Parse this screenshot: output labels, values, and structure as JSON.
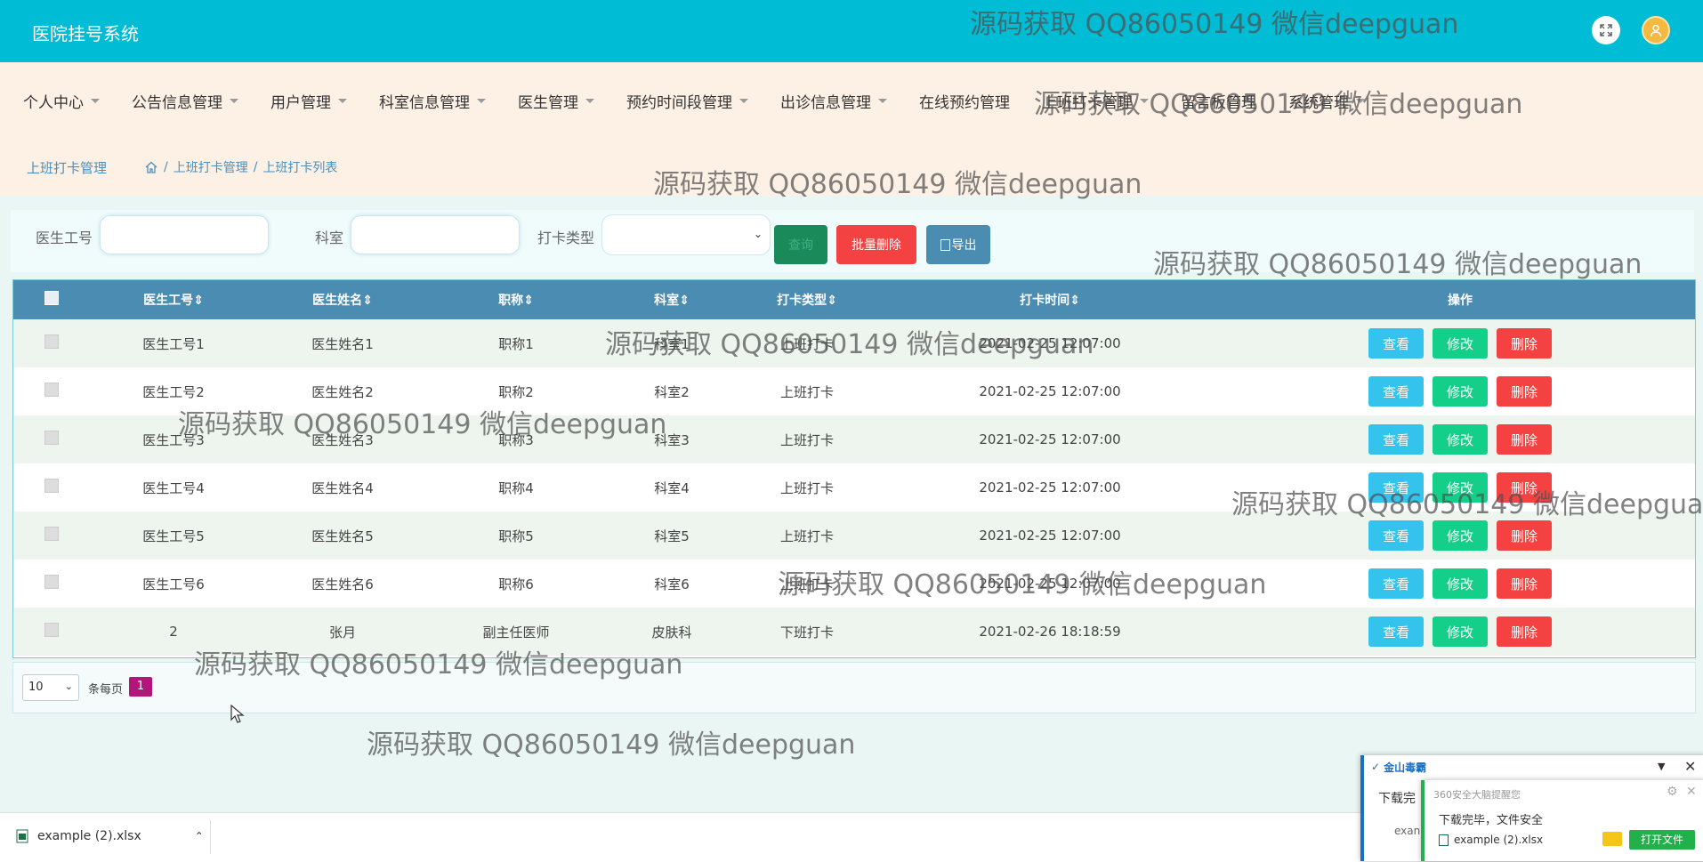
{
  "header": {
    "title": "医院挂号系统"
  },
  "nav": {
    "items": [
      {
        "label": "个人中心",
        "caret": true
      },
      {
        "label": "公告信息管理",
        "caret": true
      },
      {
        "label": "用户管理",
        "caret": true
      },
      {
        "label": "科室信息管理",
        "caret": true
      },
      {
        "label": "医生管理",
        "caret": true
      },
      {
        "label": "预约时间段管理",
        "caret": true
      },
      {
        "label": "出诊信息管理",
        "caret": true
      },
      {
        "label": "在线预约管理",
        "caret": false
      },
      {
        "label": "上班打卡管理",
        "caret": true
      },
      {
        "label": "留言板管理",
        "caret": false
      },
      {
        "label": "系统管理",
        "caret": true
      }
    ]
  },
  "breadcrumb": {
    "title": "上班打卡管理",
    "sep": "/",
    "level1": "上班打卡管理",
    "level2": "上班打卡列表"
  },
  "search": {
    "doctor_id_label": "医生工号",
    "dept_label": "科室",
    "type_label": "打卡类型",
    "search_btn": "查询",
    "batch_delete_btn": "批量删除",
    "export_btn": "导出"
  },
  "table": {
    "headers": [
      "医生工号",
      "医生姓名",
      "职称",
      "科室",
      "打卡类型",
      "打卡时间",
      "操作"
    ],
    "rows": [
      [
        "医生工号1",
        "医生姓名1",
        "职称1",
        "科室1",
        "上班打卡",
        "2021-02-25 12:07:00"
      ],
      [
        "医生工号2",
        "医生姓名2",
        "职称2",
        "科室2",
        "上班打卡",
        "2021-02-25 12:07:00"
      ],
      [
        "医生工号3",
        "医生姓名3",
        "职称3",
        "科室3",
        "上班打卡",
        "2021-02-25 12:07:00"
      ],
      [
        "医生工号4",
        "医生姓名4",
        "职称4",
        "科室4",
        "上班打卡",
        "2021-02-25 12:07:00"
      ],
      [
        "医生工号5",
        "医生姓名5",
        "职称5",
        "科室5",
        "上班打卡",
        "2021-02-25 12:07:00"
      ],
      [
        "医生工号6",
        "医生姓名6",
        "职称6",
        "科室6",
        "上班打卡",
        "2021-02-25 12:07:00"
      ],
      [
        "2",
        "张月",
        "副主任医师",
        "皮肤科",
        "下班打卡",
        "2021-02-26 18:18:59"
      ]
    ],
    "view_label": "查看",
    "edit_label": "修改",
    "delete_label": "删除"
  },
  "pagination": {
    "page_size": "10",
    "per_page_label": "条每页",
    "current_page": "1"
  },
  "watermark": "源码获取 QQ86050149 微信deepguan",
  "download": {
    "file": "example (2).xlsx"
  },
  "antivirus": {
    "title": "金山毒霸",
    "partial_text": "下载完",
    "partial_file": "exan",
    "notice_title": "360安全大脑提醒您",
    "notice_text": "下载完毕，文件安全",
    "notice_file": "example (2).xlsx",
    "open_btn": "打开文件"
  },
  "colors": {
    "header": "#00bcd4",
    "nav_bg": "#fdf1e5",
    "table_head": "#4b8cb2",
    "view": "#33c3ed",
    "edit": "#13cf8a",
    "delete": "#f44242",
    "page_active": "#b1167a"
  }
}
